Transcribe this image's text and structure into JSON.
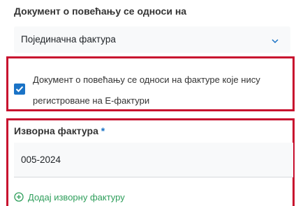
{
  "domain_fields": {
    "increase_doc_label": "Документ о повећању се односи на",
    "increase_doc_select": {
      "selected": "Појединачна фактура",
      "icon": "chevron-down-icon"
    },
    "checkbox": {
      "checked": true,
      "label_line1": "Документ о повећању се односи на фактуре које нису",
      "label_line2": "регистроване на Е-фактури"
    },
    "source_invoice": {
      "label": "Изворна фактура",
      "required_mark": "*",
      "value": "005-2024"
    },
    "add_source_invoice": {
      "label": "Додај изворну фактуру",
      "icon": "plus-circle-icon"
    }
  },
  "colors": {
    "highlight_border": "#c8102e",
    "checkbox": "#1a73c6",
    "link": "#2e9e5b",
    "required": "#1a73c6",
    "field_bg": "#f8f9fa"
  }
}
